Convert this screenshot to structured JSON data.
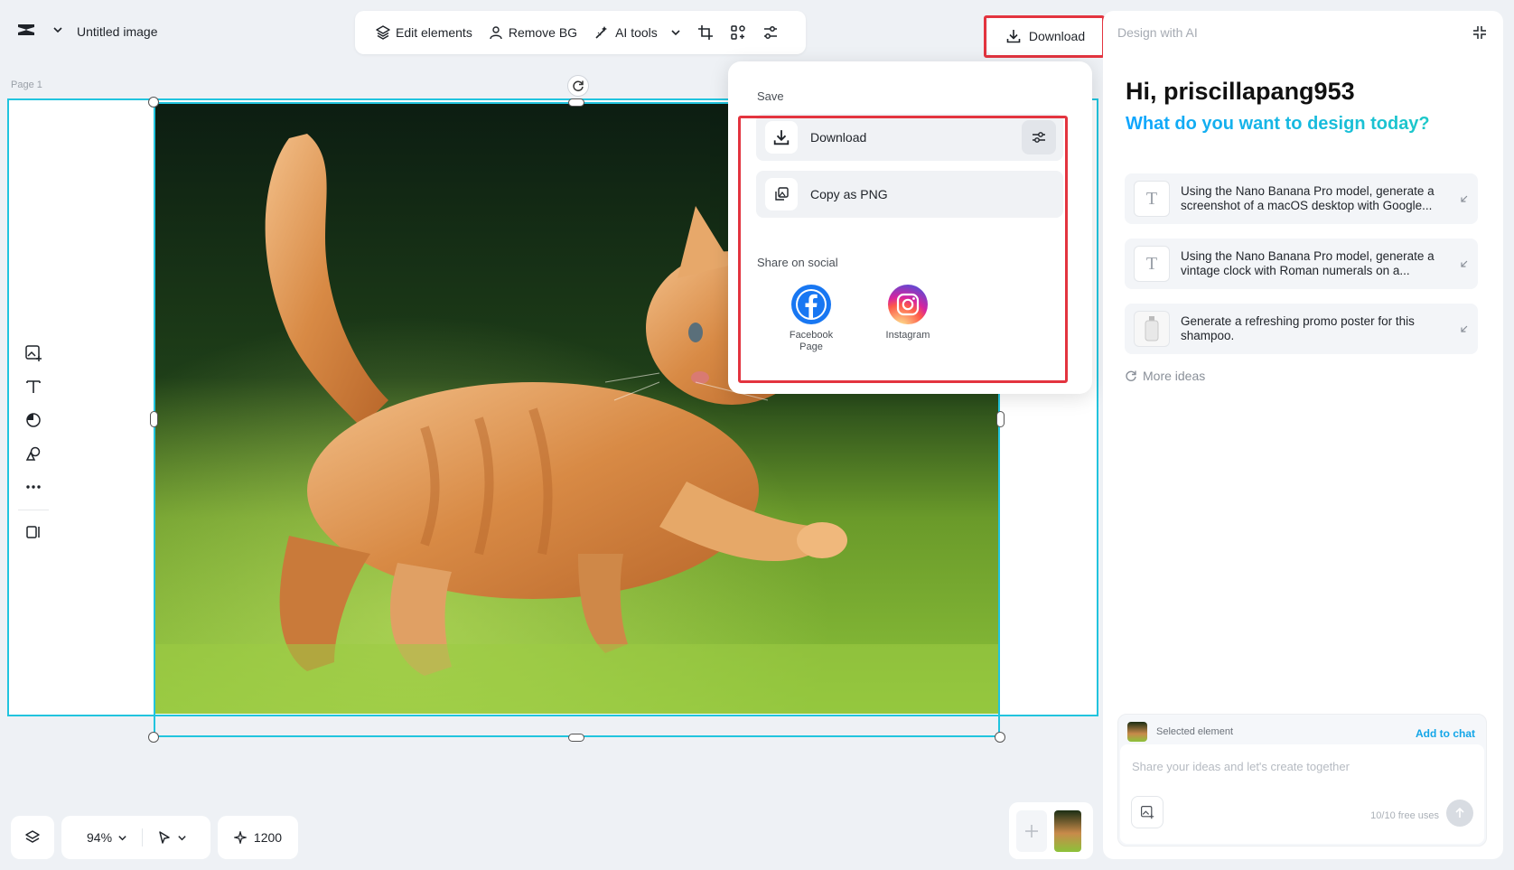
{
  "header": {
    "doc_title": "Untitled image",
    "toolbar": {
      "edit_elements": "Edit elements",
      "remove_bg": "Remove BG",
      "ai_tools": "AI tools"
    },
    "download_label": "Download"
  },
  "canvas": {
    "page_label": "Page 1"
  },
  "bottom_bar": {
    "zoom": "94%",
    "credits": "1200"
  },
  "download_menu": {
    "save_heading": "Save",
    "download_item": "Download",
    "copy_png_item": "Copy as PNG",
    "share_heading": "Share on social",
    "social": [
      {
        "label": "Facebook Page",
        "icon": "facebook-icon",
        "color": "#1877f2"
      },
      {
        "label": "Instagram",
        "icon": "instagram-icon"
      }
    ]
  },
  "ai_panel": {
    "heading": "Design with AI",
    "greeting": "Hi, priscillapang953",
    "prompt": "What do you want to design today?",
    "ideas": [
      {
        "text": "Using the Nano Banana Pro model, generate a screenshot of a macOS desktop with Google..."
      },
      {
        "text": "Using the Nano Banana Pro model, generate a vintage clock with Roman numerals on a..."
      },
      {
        "text": "Generate a refreshing promo poster for this shampoo."
      }
    ],
    "more_ideas": "More ideas",
    "selected_element": "Selected element",
    "add_to_chat": "Add to chat",
    "chat_placeholder": "Share your ideas and let's create together",
    "free_uses": "10/10 free uses"
  },
  "colors": {
    "accent": "#21c4de",
    "highlight": "#e3343f",
    "link": "#13a6e8"
  }
}
